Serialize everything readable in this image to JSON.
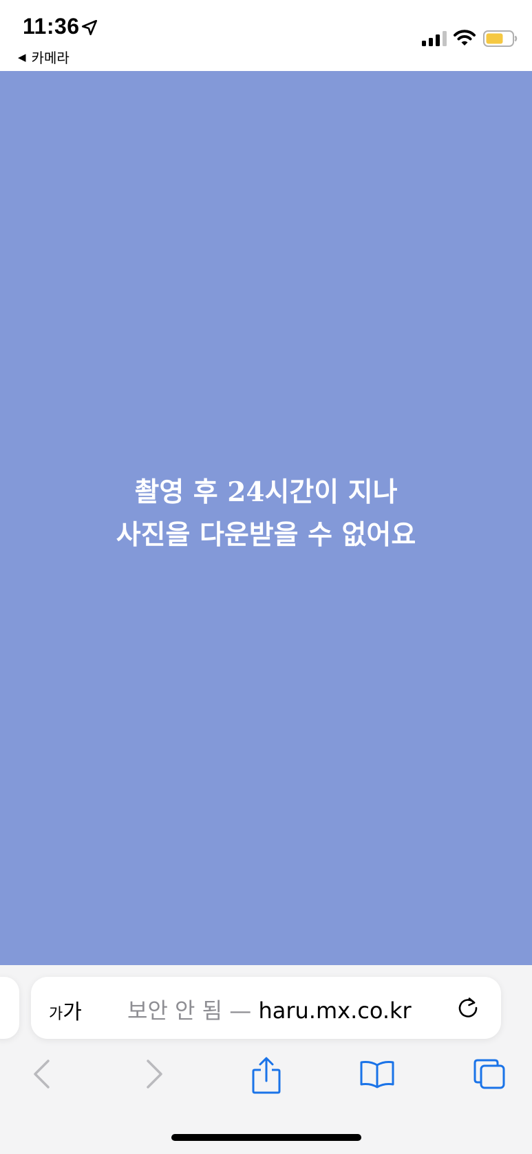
{
  "status_bar": {
    "time": "11:36",
    "back_arrow": "◀",
    "back_app_label": "카메라",
    "icons": [
      "location-arrow-icon",
      "cellular-signal-icon",
      "wifi-icon",
      "battery-icon"
    ],
    "battery_color": "#f5c842"
  },
  "content": {
    "background_color": "#8399d8",
    "message_line1": "촬영 후 24시간이 지나",
    "message_line2": "사진을 다운받을 수 없어요"
  },
  "browser": {
    "text_size_small": "가",
    "text_size_large": "가",
    "url_insecure_label": "보안 안 됨 — ",
    "url_domain": "haru.mx.co.kr",
    "toolbar_icons": [
      "back-chevron-icon",
      "forward-chevron-icon",
      "share-icon",
      "bookmarks-book-icon",
      "tabs-icon"
    ],
    "accent_color": "#1a73e8"
  }
}
